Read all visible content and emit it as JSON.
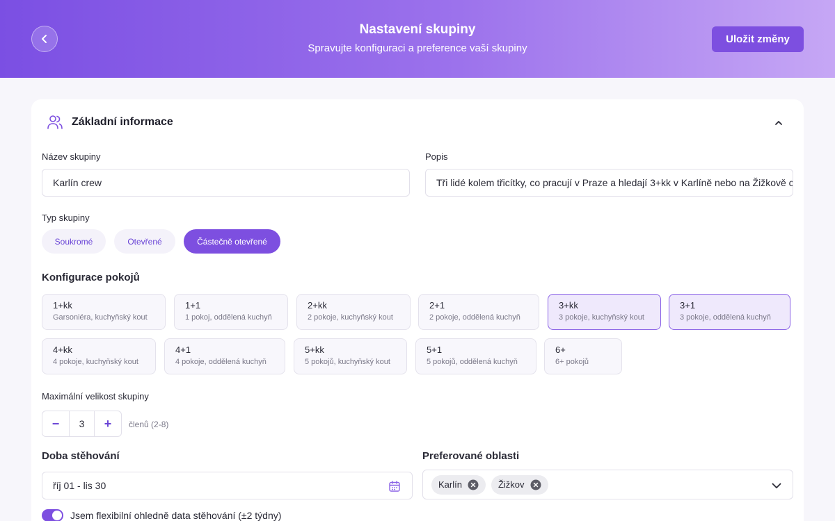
{
  "header": {
    "title": "Nastavení skupiny",
    "subtitle": "Spravujte konfiguraci a preference vaší skupiny",
    "save_label": "Uložit změny",
    "back_icon": "chevron-left-icon"
  },
  "basic": {
    "title": "Základní informace",
    "icon": "users-icon",
    "name_label": "Název skupiny",
    "name_value": "Karlín crew",
    "desc_label": "Popis",
    "desc_value": "Tři lidé kolem třicítky, co pracují v Praze a hledají 3+kk v Karlíně nebo na Žižkově c",
    "type_label": "Typ skupiny",
    "types": [
      "Soukromé",
      "Otevřené",
      "Částečně otevřené"
    ],
    "selected_type": "Částečně otevřené"
  },
  "rooms": {
    "label": "Konfigurace pokojů",
    "items": [
      {
        "code": "1+kk",
        "desc": "Garsoniéra, kuchyňský kout",
        "selected": false
      },
      {
        "code": "1+1",
        "desc": "1 pokoj, oddělená kuchyň",
        "selected": false
      },
      {
        "code": "2+kk",
        "desc": "2 pokoje, kuchyňský kout",
        "selected": false
      },
      {
        "code": "2+1",
        "desc": "2 pokoje, oddělená kuchyň",
        "selected": false
      },
      {
        "code": "3+kk",
        "desc": "3 pokoje, kuchyňský kout",
        "selected": true
      },
      {
        "code": "3+1",
        "desc": "3 pokoje, oddělená kuchyň",
        "selected": true
      },
      {
        "code": "4+kk",
        "desc": "4 pokoje, kuchyňský kout",
        "selected": false
      },
      {
        "code": "4+1",
        "desc": "4 pokoje, oddělená kuchyň",
        "selected": false
      },
      {
        "code": "5+kk",
        "desc": "5 pokojů, kuchyňský kout",
        "selected": false
      },
      {
        "code": "5+1",
        "desc": "5 pokojů, oddělená kuchyň",
        "selected": false
      },
      {
        "code": "6+",
        "desc": "6+ pokojů",
        "selected": false
      }
    ]
  },
  "size": {
    "label": "Maximální velikost skupiny",
    "minus": "−",
    "value": "3",
    "plus": "+",
    "hint": "členů (2-8)"
  },
  "moving": {
    "label": "Doba stěhování",
    "value": "říj 01 - lis 30",
    "flexible_label": "Jsem flexibilní ohledně data stěhování (±2 týdny)",
    "flexible": true
  },
  "areas": {
    "label": "Preferované oblasti",
    "chips": [
      "Karlín",
      "Žižkov"
    ]
  },
  "colors": {
    "accent": "#7d4fe0",
    "header_gradient_start": "#7b4fe3",
    "header_gradient_end": "#c6a7f5"
  }
}
